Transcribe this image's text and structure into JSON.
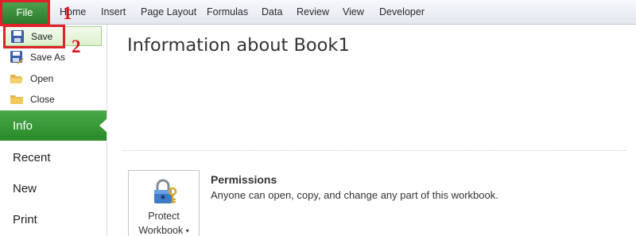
{
  "ribbon": {
    "file_label": "File",
    "tabs": [
      "Home",
      "Insert",
      "Page Layout",
      "Formulas",
      "Data",
      "Review",
      "View",
      "Developer"
    ]
  },
  "backstage": {
    "commands": [
      {
        "label": "Save",
        "icon": "save-icon"
      },
      {
        "label": "Save As",
        "icon": "save-as-icon"
      },
      {
        "label": "Open",
        "icon": "open-folder-icon"
      },
      {
        "label": "Close",
        "icon": "close-folder-icon"
      }
    ],
    "nav": [
      "Info",
      "Recent",
      "New",
      "Print"
    ],
    "selected_nav": "Info"
  },
  "main": {
    "title": "Information about Book1",
    "protect_button": {
      "line1": "Protect",
      "line2": "Workbook",
      "icon": "lock-keys-icon"
    },
    "permissions": {
      "title": "Permissions",
      "description": "Anyone can open, copy, and change any part of this workbook."
    }
  },
  "annotations": {
    "step1": "1",
    "step2": "2",
    "color": "#e0202a"
  },
  "colors": {
    "accent_green": "#2b8a2b",
    "annotation_red": "#d8131b"
  }
}
